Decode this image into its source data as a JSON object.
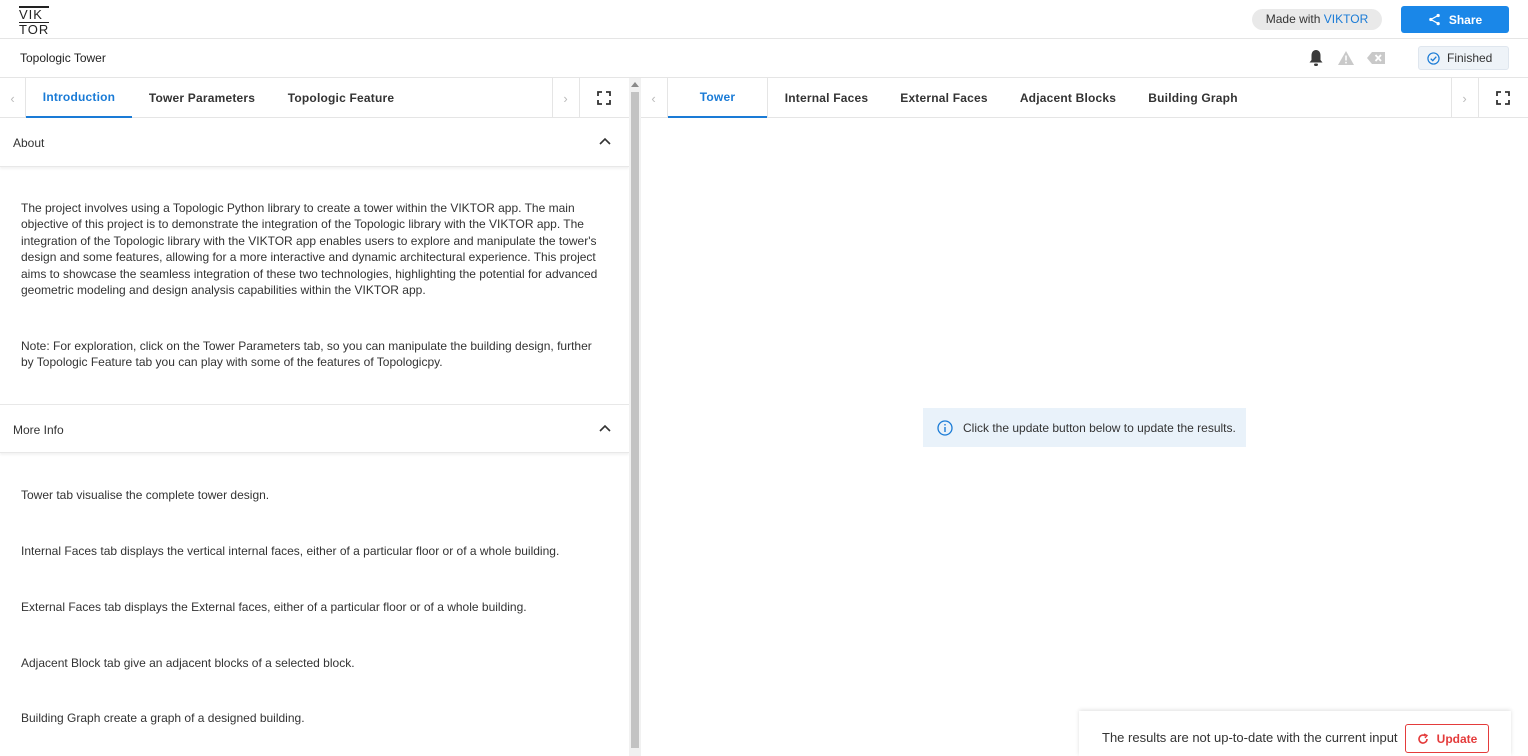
{
  "topbar": {
    "logo_line1": "VIK",
    "logo_line2": "TOR",
    "made_with_prefix": "Made with ",
    "made_with_brand": "VIKTOR",
    "share_label": "Share",
    "accent": "#1a87e8"
  },
  "appbar": {
    "title": "Topologic Tower",
    "status_label": "Finished",
    "icons": [
      "bell-icon",
      "warning-icon",
      "clear-icon",
      "check-circle-icon"
    ]
  },
  "left_tabs": [
    "Introduction",
    "Tower Parameters",
    "Topologic Feature"
  ],
  "left_active_tab": "Introduction",
  "right_tabs": [
    "Tower",
    "Internal Faces",
    "External Faces",
    "Adjacent Blocks",
    "Building Graph"
  ],
  "right_active_tab": "Tower",
  "sections": {
    "about": {
      "title": "About",
      "text1": "The project involves using a Topologic Python library to create a tower within the VIKTOR app. The main objective of this project is to demonstrate the integration of the Topologic library with the VIKTOR app. The integration of the Topologic library with the VIKTOR app enables users to explore and manipulate the tower's design and some features, allowing for a more interactive and dynamic architectural experience. This project aims to showcase the seamless integration of these two technologies, highlighting the potential for advanced geometric modeling and design analysis capabilities within the VIKTOR app.",
      "text2": "Note: For exploration, click on the Tower Parameters tab, so you can manipulate the building design, further by Topologic Feature tab you can play with some of the features of Topologicpy."
    },
    "more_info": {
      "title": "More Info",
      "items": [
        "Tower tab visualise the complete tower design.",
        "Internal Faces tab displays the vertical internal faces, either of a particular floor or of a whole building.",
        "External Faces tab displays the External faces, either of a particular floor or of a whole building.",
        "Adjacent Block tab give an adjacent blocks of a selected block.",
        "Building Graph create a graph of a designed building."
      ]
    }
  },
  "view": {
    "info_message": "Click the update button below to update the results."
  },
  "footer": {
    "message": "The results are not up-to-date with the current input",
    "update_label": "Update",
    "update_color": "#e43b3b"
  }
}
